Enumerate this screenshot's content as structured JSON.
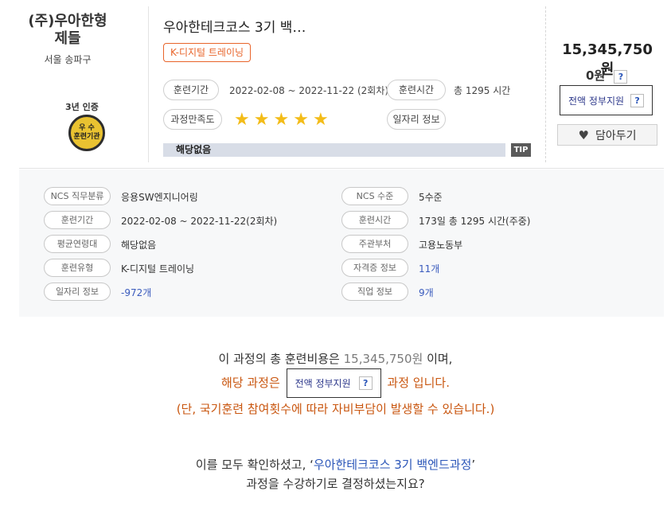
{
  "company": {
    "name_line1": "(주)우아한형",
    "name_line2": "제들",
    "location": "서울 송파구"
  },
  "certification": {
    "years_label": "3년 인증",
    "badge_line1": "우 수",
    "badge_line2": "훈련기관"
  },
  "course": {
    "title": "우아한테크코스 3기 백…",
    "tag": "K-디지털 트레이닝",
    "period_label": "훈련기간",
    "period_value": "2022-02-08 ~ 2022-11-22 (2회차)",
    "hours_label": "훈련시간",
    "hours_value": "총 1295 시간",
    "satisfaction_label": "과정만족도",
    "satisfaction_stars": 5,
    "job_info_label": "일자리 정보",
    "none_text": "해당없음",
    "tip_label": "TIP"
  },
  "pricing": {
    "total_price": "15,345,750원",
    "self_pay": "0원",
    "question_mark": "?",
    "gov_support_label": "전액 정부지원",
    "wishlist_label": "담아두기"
  },
  "details": {
    "left": [
      {
        "label": "NCS 직무분류",
        "value": "응용SW엔지니어링",
        "link": false
      },
      {
        "label": "훈련기간",
        "value": "2022-02-08 ~ 2022-11-22(2회차)",
        "link": false
      },
      {
        "label": "평균연령대",
        "value": "해당없음",
        "link": false
      },
      {
        "label": "훈련유형",
        "value": "K-디지털 트레이닝",
        "link": false
      },
      {
        "label": "일자리 정보",
        "value": "-972개",
        "link": true
      }
    ],
    "right": [
      {
        "label": "NCS 수준",
        "value": "5수준",
        "link": false
      },
      {
        "label": "훈련시간",
        "value": "173일 총 1295 시간(주중)",
        "link": false
      },
      {
        "label": "주관부처",
        "value": "고용노동부",
        "link": false
      },
      {
        "label": "자격증 정보",
        "value": "11개",
        "link": true
      },
      {
        "label": "직업 정보",
        "value": "9개",
        "link": true
      }
    ]
  },
  "summary": {
    "line1_prefix": "이 과정의 총 훈련비용은 ",
    "line1_amount": "15,345,750원",
    "line1_suffix": " 이며,",
    "line2_prefix": "해당 과정은",
    "line2_box_label": "전액 정부지원",
    "line2_suffix": "과정 입니다.",
    "line3": "(단, 국기훈련 참여횟수에 따라 자비부담이 발생할 수 있습니다.)",
    "confirm_prefix": "이를 모두 확인하셨고, ‘",
    "confirm_course": "우아한테크코스 3기 백엔드과정",
    "confirm_suffix": "’",
    "confirm_line2": "과정을 수강하기로 결정하셨는지요?"
  },
  "colors": {
    "accent_orange": "#e8642a",
    "star": "#f3bc18",
    "link_blue": "#3a5bbd",
    "notice_orange": "#c9560f"
  }
}
